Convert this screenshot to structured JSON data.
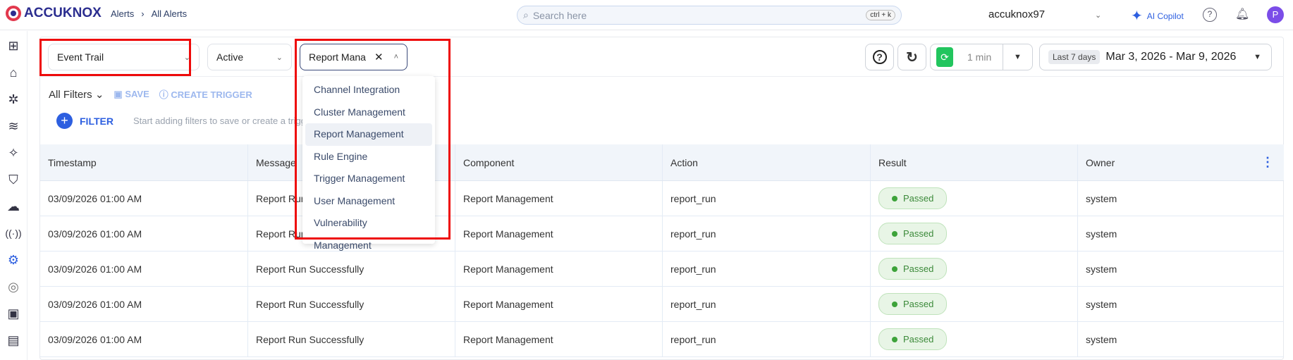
{
  "header": {
    "brand": "ACCUKNOX",
    "breadcrumb": [
      "Alerts",
      "All Alerts"
    ],
    "search_placeholder": "Search here",
    "search_shortcut": "ctrl + k",
    "tenant": "accuknox97",
    "copilot": "AI Copilot",
    "avatar": "P"
  },
  "sidebar": {
    "icons": [
      "dashboard-icon",
      "inventory-icon",
      "bug-icon",
      "layers-icon",
      "ai-sparkle-icon",
      "shield-icon",
      "cloud-icon",
      "signal-icon",
      "alert-icon",
      "fingerprint-icon",
      "settings-badge-icon",
      "report-icon"
    ],
    "active": "alert-icon"
  },
  "toolbar": {
    "view": "Event Trail",
    "status": "Active",
    "component_filter": "Report Mana",
    "refresh_interval": "1 min",
    "range_badge": "Last 7 days",
    "date_range": "Mar 3, 2026 - Mar 9, 2026"
  },
  "filters": {
    "all_filters": "All Filters",
    "save": "SAVE",
    "create_trigger": "CREATE TRIGGER",
    "filter": "FILTER",
    "hint": "Start adding filters to save or create a trigger"
  },
  "dropdown": {
    "options": [
      "Channel Integration",
      "Cluster Management",
      "Report Management",
      "Rule Engine",
      "Trigger Management",
      "User Management",
      "Vulnerability Management"
    ],
    "selected": "Report Management"
  },
  "table": {
    "columns": [
      "Timestamp",
      "Message",
      "Component",
      "Action",
      "Result",
      "Owner"
    ],
    "rows": [
      [
        "03/09/2026 01:00 AM",
        "Report Run Successfully",
        "Report Management",
        "report_run",
        "Passed",
        "system"
      ],
      [
        "03/09/2026 01:00 AM",
        "Report Run Successfully",
        "Report Management",
        "report_run",
        "Passed",
        "system"
      ],
      [
        "03/09/2026 01:00 AM",
        "Report Run Successfully",
        "Report Management",
        "report_run",
        "Passed",
        "system"
      ],
      [
        "03/09/2026 01:00 AM",
        "Report Run Successfully",
        "Report Management",
        "report_run",
        "Passed",
        "system"
      ],
      [
        "03/09/2026 01:00 AM",
        "Report Run Successfully",
        "Report Management",
        "report_run",
        "Passed",
        "system"
      ]
    ]
  },
  "colors": {
    "accent": "#2d5fe0",
    "highlight": "#ee0a0a",
    "passed": "#3c8a3a",
    "refresh": "#22c55e"
  }
}
